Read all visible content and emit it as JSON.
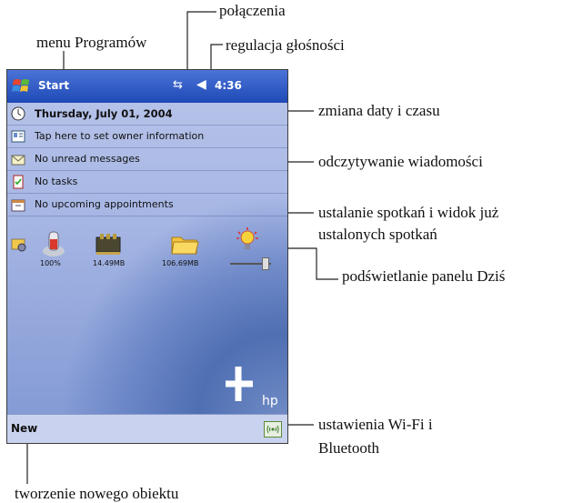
{
  "callouts": {
    "connections": "połączenia",
    "programs_menu": "menu Programów",
    "volume": "regulacja głośności",
    "date_time": "zmiana daty i czasu",
    "messages": "odczytywanie wiadomości",
    "appointments_line1": "ustalanie spotkań i widok już",
    "appointments_line2": "ustalonych spotkań",
    "backlight": "podświetlanie panelu Dziś",
    "wifi_line1": "ustawienia Wi-Fi i",
    "wifi_line2": "Bluetooth",
    "new_object": "tworzenie nowego obiektu"
  },
  "device": {
    "taskbar": {
      "start_label": "Start",
      "time": "4:36"
    },
    "today_rows": [
      {
        "text": "Thursday, July 01, 2004",
        "icon": "clock-icon"
      },
      {
        "text": "Tap here to set owner information",
        "icon": "owner-card-icon"
      },
      {
        "text": "No unread messages",
        "icon": "envelope-icon"
      },
      {
        "text": "No tasks",
        "icon": "tasks-icon"
      },
      {
        "text": "No upcoming appointments",
        "icon": "calendar-icon"
      }
    ],
    "status": {
      "battery_label": "100%",
      "memory_label": "14.49MB",
      "storage_label": "106.69MB"
    },
    "menubar": {
      "new_label": "New"
    },
    "logo_text": "hp"
  }
}
